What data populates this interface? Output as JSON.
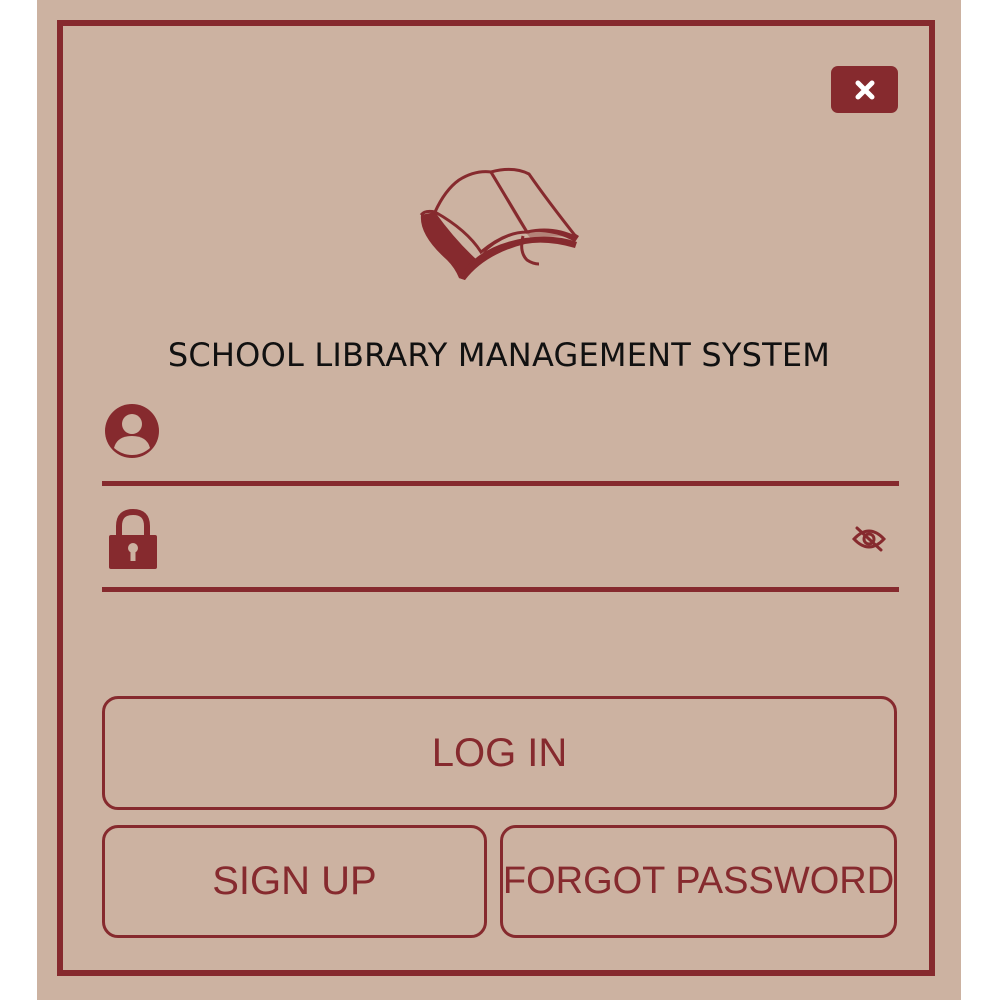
{
  "app": {
    "title": "SCHOOL LIBRARY MANAGEMENT SYSTEM"
  },
  "colors": {
    "background": "#ccb2a1",
    "accent": "#862a2e",
    "title_text": "#111111"
  },
  "icons": {
    "close": "close-icon",
    "logo": "open-book-icon",
    "username": "user-circle-icon",
    "password": "padlock-icon",
    "toggle_password": "eye-slash-icon"
  },
  "form": {
    "username": {
      "value": "",
      "placeholder": ""
    },
    "password": {
      "value": "",
      "placeholder": ""
    }
  },
  "buttons": {
    "login": "LOG IN",
    "signup": "SIGN UP",
    "forgot": "FORGOT PASSWORD"
  }
}
